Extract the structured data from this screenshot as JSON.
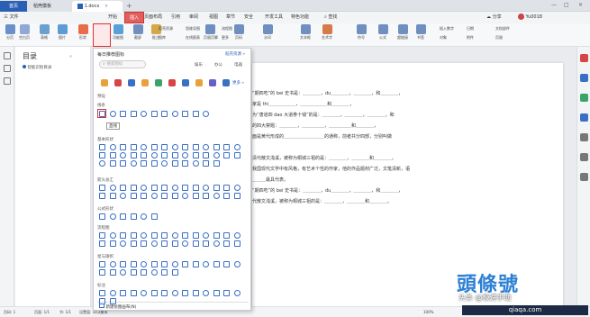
{
  "tabs": {
    "home": "首页",
    "template": "稻壳模板",
    "doc": "1.docx",
    "close": "×",
    "plus": "+"
  },
  "window": {
    "min": "—",
    "max": "□",
    "close": "×"
  },
  "menu": {
    "file": "三 文件",
    "items": [
      "开始",
      "插入",
      "页面布局",
      "引用",
      "审阅",
      "视图",
      "章节",
      "安全",
      "开发工具",
      "特色功能"
    ],
    "search": "查找",
    "share": "分享",
    "user": "Yu0018"
  },
  "ribbon": {
    "labels": [
      "分页",
      "空白页",
      "表格",
      "图片",
      "形状",
      "图标库",
      "功能图",
      "截屏",
      "批注",
      "页眉页脚",
      "页码",
      "水印",
      "文本框",
      "艺术字",
      "符号",
      "公式",
      "超链接",
      "书签"
    ],
    "small": [
      "稻壳资源",
      "图库",
      "思维导图",
      "在线图表",
      "流程图",
      "更多",
      "插入数字",
      "对象",
      "日期",
      "附件",
      "文档部件",
      "页眉"
    ]
  },
  "nav": {
    "title": "目录",
    "item": "智能识别目录"
  },
  "dropdown": {
    "title": "每日推荐图标",
    "more": "稻壳资源 »",
    "search_placeholder": "搜索图标",
    "search_tabs": [
      "娱乐",
      "办公",
      "电器"
    ],
    "more_icons": "更多 »",
    "preset": "预设",
    "lines": "线条",
    "tooltip": "直线",
    "basic": "基本形状",
    "arrows": "箭头总汇",
    "formula": "公式形状",
    "flowchart": "流程图",
    "stars": "星与旗帜",
    "callout": "标注",
    "new_canvas": "新建绘图画布(N)"
  },
  "doc": {
    "lines": [
      "“期四吃”的 bei 史书是：＿＿＿＿，du＿＿＿＿，＿＿＿＿，和＿＿＿＿，",
      "家是 thi＿＿＿＿＿＿，＿＿＿＿＿＿和＿＿＿＿，",
      "为“唐道四 dao 大道券十钱”的是：＿＿＿＿，＿＿＿＿，＿＿＿＿，和",
      "的四大禁题：＿＿＿＿，＿＿＿＿＿，＿＿＿＿＿和＿＿＿＿，",
      "面是黄代形成的＿＿＿＿＿＿＿＿＿的通称，前者共分四部，分别叫做",
      "",
      "清代散文浅溪，被称为桐城三祖的是：＿＿＿＿，＿＿＿＿和＿＿＿＿。",
      "我国现代文学中有风格，有艺术个性的作家，他的作品题材广泛，文笔清新，语",
      "＿＿＿最具代表。",
      "“期四吃”的 bei 史书是：＿＿＿＿，du＿＿＿＿，＿＿＿＿，和＿＿＿＿，",
      "代散文浅溪，被称为桐城三祖的是：＿＿＿＿，＿＿＿＿和＿＿＿＿。"
    ]
  },
  "status": {
    "page": "页码: 1",
    "pages": "页面: 1/1",
    "section": "节: 1/1",
    "words": "设置值: 10.2厘米",
    "zoom": "100%"
  },
  "watermark": {
    "logo": "頭條號",
    "text": "头条 @极速手助",
    "url": "qiaqa.com"
  },
  "colors": {
    "accent": "#e03030",
    "brand": "#2b5fb4",
    "icon": "#3a6fc4"
  }
}
